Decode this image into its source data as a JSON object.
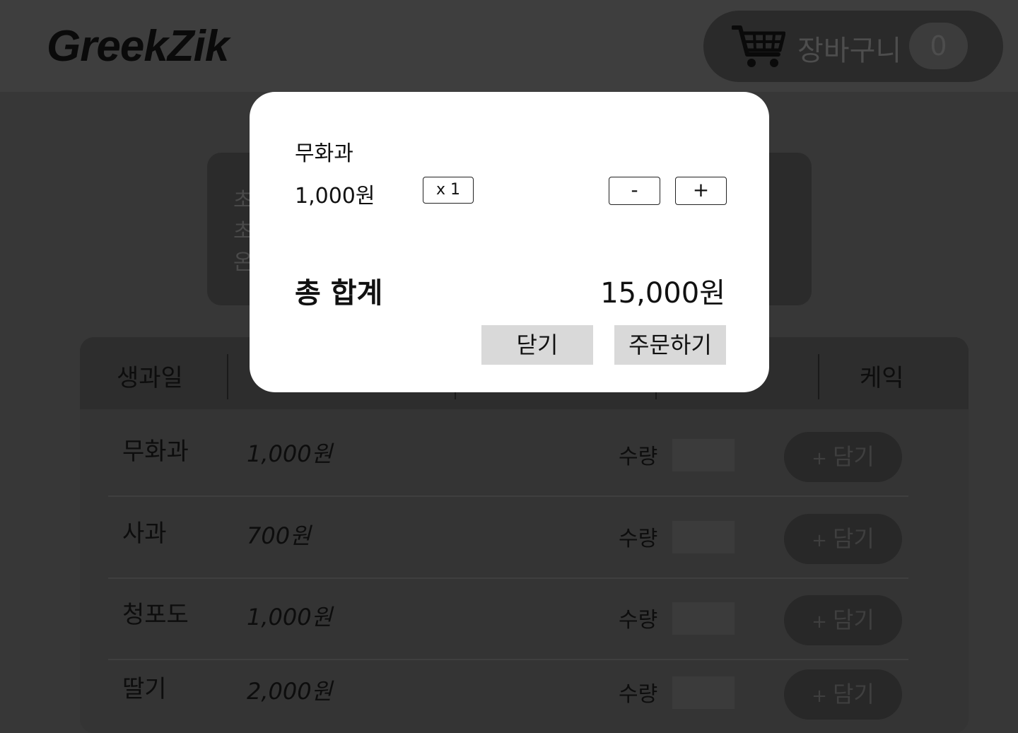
{
  "header": {
    "logo": "GreekZik",
    "cart": {
      "icon": "cart-icon",
      "label": "장바구니",
      "count": "0"
    }
  },
  "notice": {
    "lines": [
      "초",
      "초",
      "온"
    ]
  },
  "tabs": [
    {
      "label": "생과일"
    },
    {
      "label": "케익"
    }
  ],
  "products": [
    {
      "name": "무화과",
      "price": "1,000원",
      "qty_label": "수량",
      "add_label": "담기"
    },
    {
      "name": "사과",
      "price": "700원",
      "qty_label": "수량",
      "add_label": "담기"
    },
    {
      "name": "청포도",
      "price": "1,000원",
      "qty_label": "수량",
      "add_label": "담기"
    },
    {
      "name": "딸기",
      "price": "2,000원",
      "qty_label": "수량",
      "add_label": "담기"
    }
  ],
  "modal": {
    "item": {
      "name": "무화과",
      "price": "1,000원",
      "qty": "x 1"
    },
    "minus": "-",
    "plus": "+",
    "total_label": "총 합계",
    "total_value": "15,000원",
    "close": "닫기",
    "order": "주문하기"
  }
}
